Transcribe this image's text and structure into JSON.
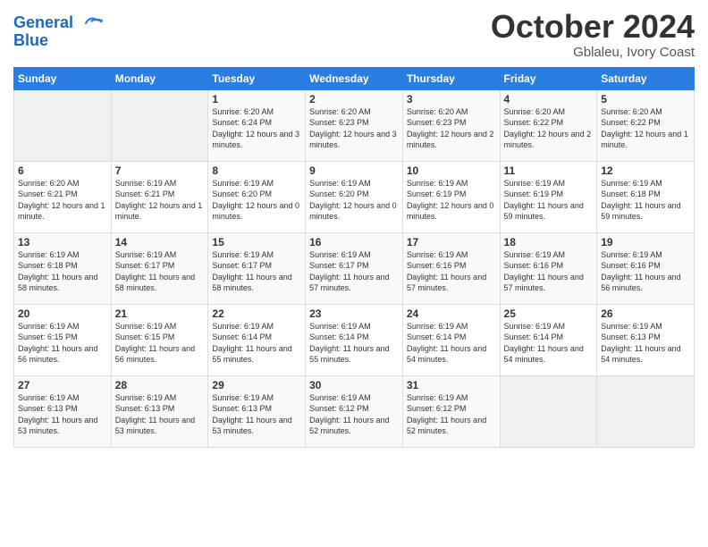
{
  "logo": {
    "line1": "General",
    "line2": "Blue"
  },
  "title": "October 2024",
  "subtitle": "Gblaleu, Ivory Coast",
  "days_of_week": [
    "Sunday",
    "Monday",
    "Tuesday",
    "Wednesday",
    "Thursday",
    "Friday",
    "Saturday"
  ],
  "weeks": [
    [
      {
        "day": "",
        "content": ""
      },
      {
        "day": "",
        "content": ""
      },
      {
        "day": "1",
        "content": "Sunrise: 6:20 AM\nSunset: 6:24 PM\nDaylight: 12 hours and 3 minutes."
      },
      {
        "day": "2",
        "content": "Sunrise: 6:20 AM\nSunset: 6:23 PM\nDaylight: 12 hours and 3 minutes."
      },
      {
        "day": "3",
        "content": "Sunrise: 6:20 AM\nSunset: 6:23 PM\nDaylight: 12 hours and 2 minutes."
      },
      {
        "day": "4",
        "content": "Sunrise: 6:20 AM\nSunset: 6:22 PM\nDaylight: 12 hours and 2 minutes."
      },
      {
        "day": "5",
        "content": "Sunrise: 6:20 AM\nSunset: 6:22 PM\nDaylight: 12 hours and 1 minute."
      }
    ],
    [
      {
        "day": "6",
        "content": "Sunrise: 6:20 AM\nSunset: 6:21 PM\nDaylight: 12 hours and 1 minute."
      },
      {
        "day": "7",
        "content": "Sunrise: 6:19 AM\nSunset: 6:21 PM\nDaylight: 12 hours and 1 minute."
      },
      {
        "day": "8",
        "content": "Sunrise: 6:19 AM\nSunset: 6:20 PM\nDaylight: 12 hours and 0 minutes."
      },
      {
        "day": "9",
        "content": "Sunrise: 6:19 AM\nSunset: 6:20 PM\nDaylight: 12 hours and 0 minutes."
      },
      {
        "day": "10",
        "content": "Sunrise: 6:19 AM\nSunset: 6:19 PM\nDaylight: 12 hours and 0 minutes."
      },
      {
        "day": "11",
        "content": "Sunrise: 6:19 AM\nSunset: 6:19 PM\nDaylight: 11 hours and 59 minutes."
      },
      {
        "day": "12",
        "content": "Sunrise: 6:19 AM\nSunset: 6:18 PM\nDaylight: 11 hours and 59 minutes."
      }
    ],
    [
      {
        "day": "13",
        "content": "Sunrise: 6:19 AM\nSunset: 6:18 PM\nDaylight: 11 hours and 58 minutes."
      },
      {
        "day": "14",
        "content": "Sunrise: 6:19 AM\nSunset: 6:17 PM\nDaylight: 11 hours and 58 minutes."
      },
      {
        "day": "15",
        "content": "Sunrise: 6:19 AM\nSunset: 6:17 PM\nDaylight: 11 hours and 58 minutes."
      },
      {
        "day": "16",
        "content": "Sunrise: 6:19 AM\nSunset: 6:17 PM\nDaylight: 11 hours and 57 minutes."
      },
      {
        "day": "17",
        "content": "Sunrise: 6:19 AM\nSunset: 6:16 PM\nDaylight: 11 hours and 57 minutes."
      },
      {
        "day": "18",
        "content": "Sunrise: 6:19 AM\nSunset: 6:16 PM\nDaylight: 11 hours and 57 minutes."
      },
      {
        "day": "19",
        "content": "Sunrise: 6:19 AM\nSunset: 6:16 PM\nDaylight: 11 hours and 56 minutes."
      }
    ],
    [
      {
        "day": "20",
        "content": "Sunrise: 6:19 AM\nSunset: 6:15 PM\nDaylight: 11 hours and 56 minutes."
      },
      {
        "day": "21",
        "content": "Sunrise: 6:19 AM\nSunset: 6:15 PM\nDaylight: 11 hours and 56 minutes."
      },
      {
        "day": "22",
        "content": "Sunrise: 6:19 AM\nSunset: 6:14 PM\nDaylight: 11 hours and 55 minutes."
      },
      {
        "day": "23",
        "content": "Sunrise: 6:19 AM\nSunset: 6:14 PM\nDaylight: 11 hours and 55 minutes."
      },
      {
        "day": "24",
        "content": "Sunrise: 6:19 AM\nSunset: 6:14 PM\nDaylight: 11 hours and 54 minutes."
      },
      {
        "day": "25",
        "content": "Sunrise: 6:19 AM\nSunset: 6:14 PM\nDaylight: 11 hours and 54 minutes."
      },
      {
        "day": "26",
        "content": "Sunrise: 6:19 AM\nSunset: 6:13 PM\nDaylight: 11 hours and 54 minutes."
      }
    ],
    [
      {
        "day": "27",
        "content": "Sunrise: 6:19 AM\nSunset: 6:13 PM\nDaylight: 11 hours and 53 minutes."
      },
      {
        "day": "28",
        "content": "Sunrise: 6:19 AM\nSunset: 6:13 PM\nDaylight: 11 hours and 53 minutes."
      },
      {
        "day": "29",
        "content": "Sunrise: 6:19 AM\nSunset: 6:13 PM\nDaylight: 11 hours and 53 minutes."
      },
      {
        "day": "30",
        "content": "Sunrise: 6:19 AM\nSunset: 6:12 PM\nDaylight: 11 hours and 52 minutes."
      },
      {
        "day": "31",
        "content": "Sunrise: 6:19 AM\nSunset: 6:12 PM\nDaylight: 11 hours and 52 minutes."
      },
      {
        "day": "",
        "content": ""
      },
      {
        "day": "",
        "content": ""
      }
    ]
  ]
}
